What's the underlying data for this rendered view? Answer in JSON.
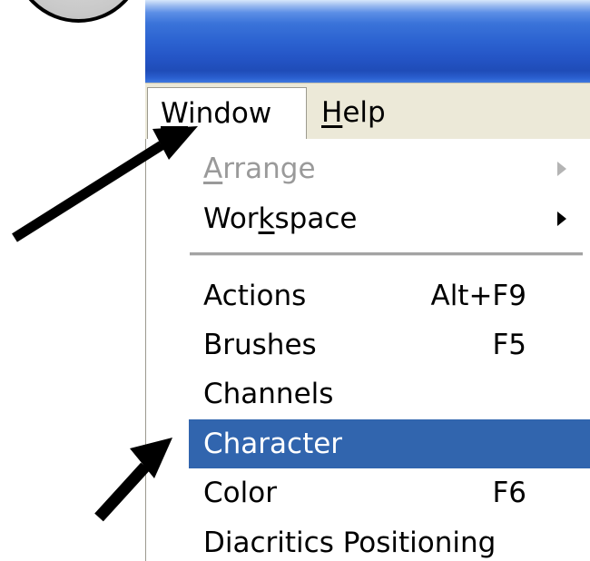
{
  "menubar": {
    "window_label_first": "W",
    "window_label_rest": "indow",
    "help_mnemonic": "H",
    "help_rest": "elp"
  },
  "dropdown": {
    "items": [
      {
        "pre": "",
        "mn": "A",
        "post": "rrange",
        "shortcut": "",
        "submenu": true,
        "disabled": true,
        "highlighted": false
      },
      {
        "pre": "Wor",
        "mn": "k",
        "post": "space",
        "shortcut": "",
        "submenu": true,
        "disabled": false,
        "highlighted": false
      },
      {
        "pre": "Actions",
        "mn": "",
        "post": "",
        "shortcut": "Alt+F9",
        "submenu": false,
        "disabled": false,
        "highlighted": false
      },
      {
        "pre": "Brushes",
        "mn": "",
        "post": "",
        "shortcut": "F5",
        "submenu": false,
        "disabled": false,
        "highlighted": false
      },
      {
        "pre": "Channels",
        "mn": "",
        "post": "",
        "shortcut": "",
        "submenu": false,
        "disabled": false,
        "highlighted": false
      },
      {
        "pre": "Character",
        "mn": "",
        "post": "",
        "shortcut": "",
        "submenu": false,
        "disabled": false,
        "highlighted": true
      },
      {
        "pre": "Color",
        "mn": "",
        "post": "",
        "shortcut": "F6",
        "submenu": false,
        "disabled": false,
        "highlighted": false
      },
      {
        "pre": "Diacritics Positioning",
        "mn": "",
        "post": "",
        "shortcut": "",
        "submenu": false,
        "disabled": false,
        "highlighted": false
      }
    ]
  },
  "colors": {
    "highlight": "#3165ae",
    "menubar_bg": "#ece9d8",
    "disabled_text": "#9a9a9a"
  }
}
